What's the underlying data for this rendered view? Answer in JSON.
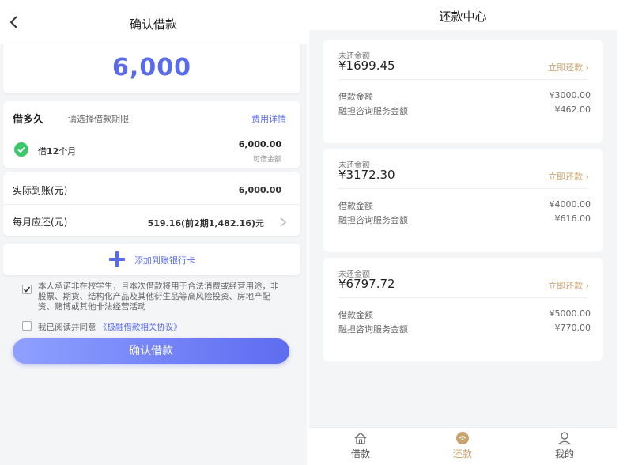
{
  "left": {
    "header": {
      "title": "确认借款"
    },
    "amount": "6,000",
    "period": {
      "label": "借多久",
      "hint": "请选择借款期限",
      "fee_link": "费用详情",
      "option_prefix": "借",
      "option_months": "12",
      "option_suffix": "个月",
      "option_amount": "6,000.00",
      "option_amount_label": "可借金额"
    },
    "actual": {
      "label": "实际到账(元)",
      "value": "6,000.00"
    },
    "monthly": {
      "label": "每月应还(元)",
      "value_main": "519.16(前2期1,482.16)",
      "value_unit": "元"
    },
    "bank": {
      "label": "添加到账银行卡"
    },
    "promise_text": "本人承诺非在校学生，且本次借款将用于合法消费或经营用途，非股票、期货、结构化产品及其他衍生品等高风险投资、房地产配资、赌博或其他非法经营活动",
    "agree": {
      "prefix": "我已阅读并同意",
      "link": "《极融借款相关协议》"
    },
    "confirm_button": "确认借款",
    "colors": {
      "accent": "#5a6bea",
      "check": "#3cc76a"
    }
  },
  "right": {
    "header": {
      "title": "还款中心"
    },
    "loans": [
      {
        "unpaid_label": "未还金额",
        "unpaid": "¥1699.45",
        "pay_link": "立即还款",
        "principal_label": "借款金额",
        "principal": "¥3000.00",
        "service_label": "融担咨询服务金额",
        "service": "¥462.00"
      },
      {
        "unpaid_label": "未还金额",
        "unpaid": "¥3172.30",
        "pay_link": "立即还款",
        "principal_label": "借款金额",
        "principal": "¥4000.00",
        "service_label": "融担咨询服务金额",
        "service": "¥616.00"
      },
      {
        "unpaid_label": "未还金额",
        "unpaid": "¥6797.72",
        "pay_link": "立即还款",
        "principal_label": "借款金额",
        "principal": "¥5000.00",
        "service_label": "融担咨询服务金额",
        "service": "¥770.00"
      }
    ],
    "tabs": [
      {
        "label": "借款",
        "icon": "home-icon"
      },
      {
        "label": "还款",
        "icon": "repay-icon",
        "active": true
      },
      {
        "label": "我的",
        "icon": "user-icon"
      }
    ],
    "colors": {
      "gold": "#c9a36b"
    }
  }
}
